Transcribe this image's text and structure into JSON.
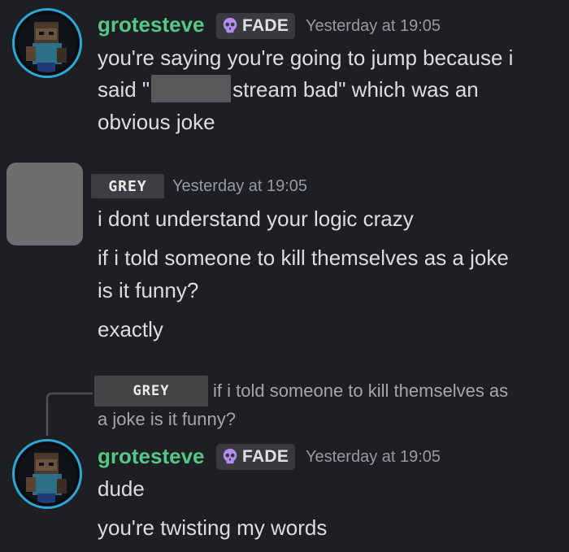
{
  "messages": [
    {
      "author": "grotesteve",
      "badge": "FADE",
      "timestamp": "Yesterday at 19:05",
      "line1": "you're saying you're going to jump because i",
      "line2_pre": "said \"",
      "line2_post": "stream bad\" which was an",
      "line3": "obvious joke"
    },
    {
      "author_tag": "GREY",
      "timestamp": "Yesterday at 19:05",
      "lines": [
        "i dont understand your logic crazy",
        "if i told someone to kill themselves as a joke",
        "is it funny?",
        "exactly"
      ]
    },
    {
      "reply_to_tag": "GREY",
      "reply_line1": "if i told someone to kill themselves as",
      "reply_line2": "a joke is it funny?",
      "author": "grotesteve",
      "badge": "FADE",
      "timestamp": "Yesterday at 19:05",
      "lines": [
        "dude",
        "you're twisting my words"
      ]
    }
  ],
  "colors": {
    "background": "#1e1f22",
    "username": "#57c785",
    "badge_bg": "#393a40",
    "badge_icon": "#b48cf0",
    "timestamp": "#949ba4",
    "avatar_ring": "#2aa8d8"
  },
  "icons": {
    "badge_icon": "skull-icon"
  }
}
